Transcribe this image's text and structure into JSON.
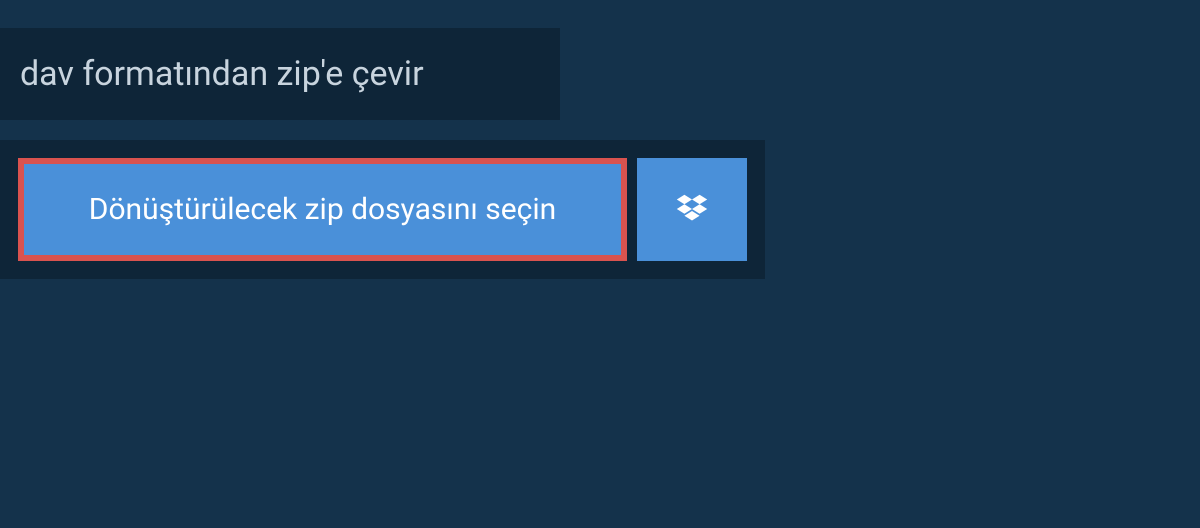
{
  "header": {
    "title": "dav formatından zip'e çevir"
  },
  "fileSelector": {
    "selectButtonLabel": "Dönüştürülecek zip dosyasını seçin"
  },
  "colors": {
    "background": "#14324b",
    "darkPanel": "#0e2538",
    "buttonBlue": "#4a90d9",
    "buttonBorderRed": "#d9534f"
  }
}
